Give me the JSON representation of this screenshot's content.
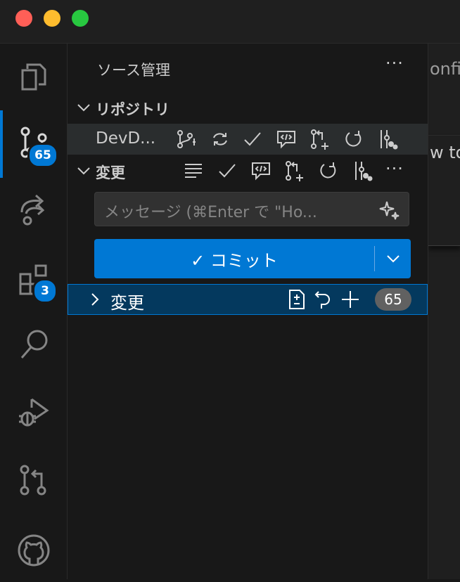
{
  "window": {
    "traffic_lights": [
      "#ff5f57",
      "#febc2e",
      "#28c840"
    ]
  },
  "activity_bar": {
    "items": [
      {
        "icon": "files-icon",
        "badge": null
      },
      {
        "icon": "source-control-icon",
        "badge": "65"
      },
      {
        "icon": "remote-share-icon",
        "badge": null
      },
      {
        "icon": "extensions-icon",
        "badge": "3"
      },
      {
        "icon": "search-icon",
        "badge": null
      },
      {
        "icon": "run-debug-icon",
        "badge": null
      },
      {
        "icon": "pull-request-icon",
        "badge": null
      },
      {
        "icon": "github-icon",
        "badge": null
      }
    ],
    "accent": "#0078d4"
  },
  "sidebar": {
    "title": "ソース管理",
    "more": "···",
    "repositories_section": {
      "label": "リポジトリ",
      "repo_name": "DevD..."
    },
    "changes_section": {
      "label": "変更",
      "more": "···"
    },
    "commit_message": {
      "placeholder": "メッセージ (⌘Enter で \"Ho..."
    },
    "commit_button": {
      "label": "✓ コミット"
    },
    "changes_group": {
      "label": "変更",
      "count": "65"
    }
  },
  "editor": {
    "tab_text": "onfi",
    "line_text": "w to"
  }
}
